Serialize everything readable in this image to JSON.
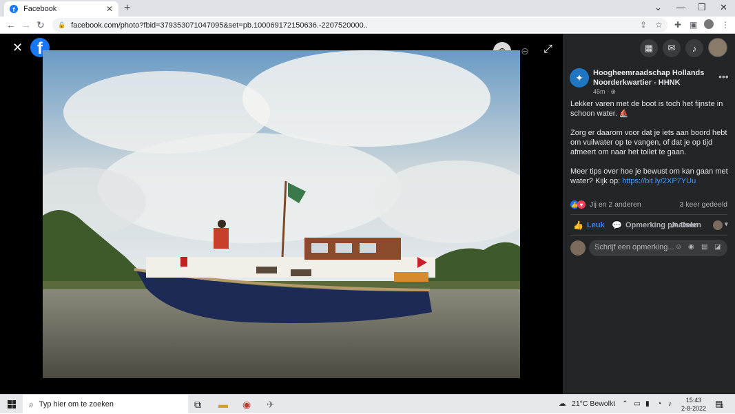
{
  "browser": {
    "tab_title": "Facebook",
    "tab_close": "✕",
    "new_tab": "+",
    "url": "facebook.com/photo?fbid=379353071047095&set=pb.100069172150636.-2207520000..",
    "window_controls": [
      "⌄",
      "—",
      "❐",
      "✕"
    ]
  },
  "viewer": {
    "close": "✕",
    "fb_logo": "f",
    "zoom_in": "⊕",
    "zoom_out": "⊖",
    "fullscreen": "⤢"
  },
  "sidebar": {
    "menu_icon": "grid-menu-icon",
    "post": {
      "page_name": "Hoogheemraadschap Hollands Noorderkwartier - HHNK",
      "time": "45m",
      "more": "•••",
      "paragraphs": [
        "Lekker varen met de boot is toch het fijnste in schoon water. ⛵",
        "Zorg er daarom voor dat je iets aan boord hebt om vuilwater op te vangen, of dat je op tijd afmeert om naar het toilet te gaan."
      ],
      "paragraph3_prefix": "Meer tips over hoe je bewust om kan gaan met water? Kijk op: ",
      "link": "https://bit.ly/2XP7YUu",
      "reactions_text": "Jij en 2 anderen",
      "shares_text": "3 keer gedeeld",
      "like_label": "Leuk",
      "comment_label": "Opmerking plaatsen",
      "share_label": "Delen",
      "comment_placeholder": "Schrijf een opmerking..."
    }
  },
  "taskbar": {
    "search_placeholder": "Typ hier om te zoeken",
    "weather": "21°C  Bewolkt",
    "time": "15:43",
    "date": "2-8-2022",
    "notification_count": "6"
  }
}
